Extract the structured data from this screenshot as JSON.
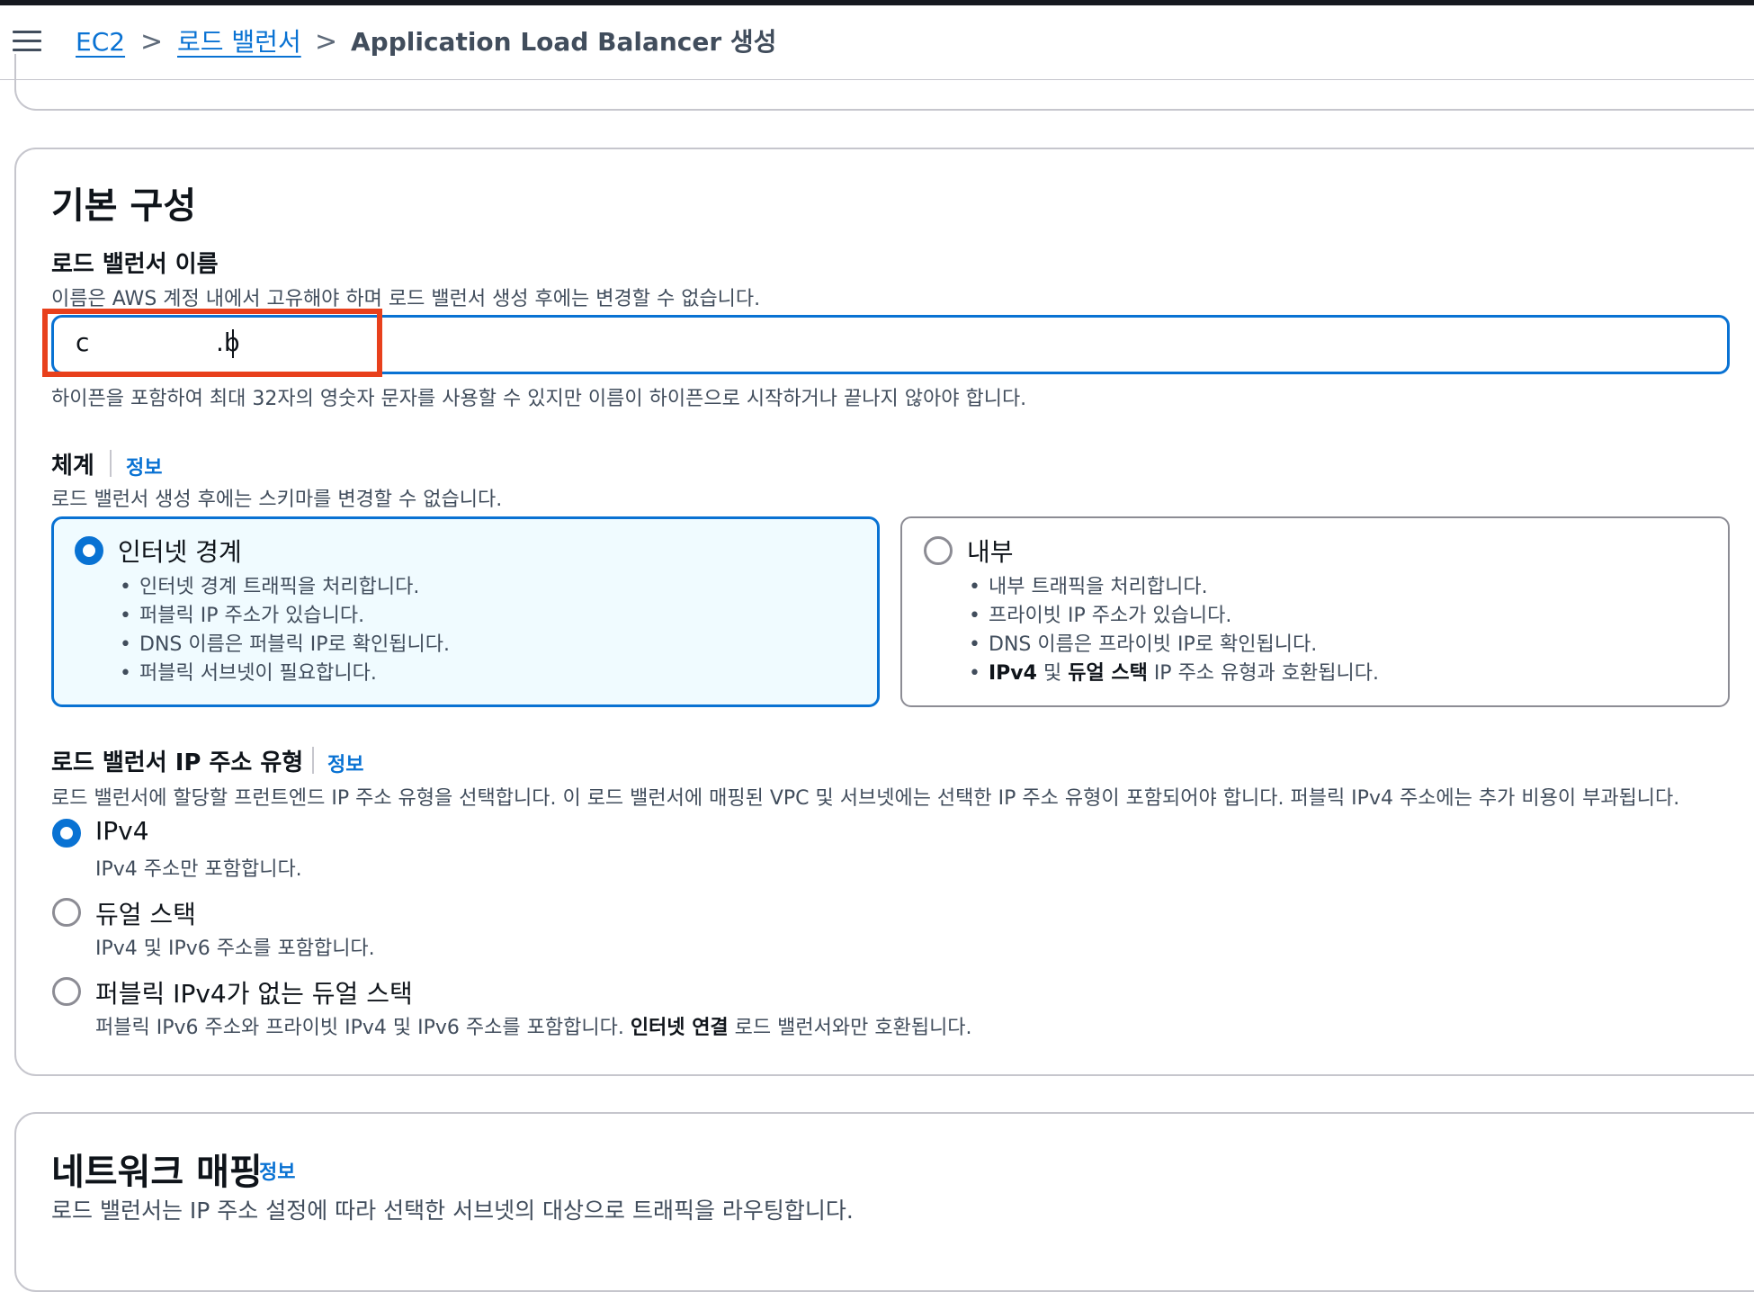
{
  "breadcrumb": {
    "ec2": "EC2",
    "load_balancers": "로드 밸런서",
    "current": "Application Load Balancer 생성",
    "separator": ">"
  },
  "basic_config": {
    "title": "기본 구성",
    "name_label": "로드 밸런서 이름",
    "name_description": "이름은 AWS 계정 내에서 고유해야 하며 로드 밸런서 생성 후에는 변경할 수 없습니다.",
    "name_value_start": "c",
    "name_value_end": ".b",
    "name_constraint": "하이픈을 포함하여 최대 32자의 영숫자 문자를 사용할 수 있지만 이름이 하이픈으로 시작하거나 끝나지 않아야 합니다.",
    "scheme": {
      "label": "체계",
      "info": "정보",
      "description": "로드 밸런서 생성 후에는 스키마를 변경할 수 없습니다.",
      "options": [
        {
          "title": "인터넷 경계",
          "selected": true,
          "bullets": [
            "인터넷 경계 트래픽을 처리합니다.",
            "퍼블릭 IP 주소가 있습니다.",
            "DNS 이름은 퍼블릭 IP로 확인됩니다.",
            "퍼블릭 서브넷이 필요합니다."
          ]
        },
        {
          "title": "내부",
          "selected": false,
          "bullets": [
            "내부 트래픽을 처리합니다.",
            "프라이빗 IP 주소가 있습니다.",
            "DNS 이름은 프라이빗 IP로 확인됩니다."
          ],
          "last_bullet": {
            "b1": "IPv4",
            "t1": " 및 ",
            "b2": "듀얼 스택",
            "t2": " IP 주소 유형과 호환됩니다."
          }
        }
      ]
    },
    "ip_type": {
      "label": "로드 밸런서 IP 주소 유형",
      "info": "정보",
      "description": "로드 밸런서에 할당할 프런트엔드 IP 주소 유형을 선택합니다. 이 로드 밸런서에 매핑된 VPC 및 서브넷에는 선택한 IP 주소 유형이 포함되어야 합니다. 퍼블릭 IPv4 주소에는 추가 비용이 부과됩니다.",
      "options": [
        {
          "title": "IPv4",
          "description": "IPv4 주소만 포함합니다.",
          "selected": true
        },
        {
          "title": "듀얼 스택",
          "description": "IPv4 및 IPv6 주소를 포함합니다.",
          "selected": false
        },
        {
          "title": "퍼블릭 IPv4가 없는 듀얼 스택",
          "selected": false,
          "desc_pre": "퍼블릭 IPv6 주소와 프라이빗 IPv4 및 IPv6 주소를 포함합니다. ",
          "desc_bold": "인터넷 연결",
          "desc_post": " 로드 밸런서와만 호환됩니다."
        }
      ]
    }
  },
  "network_mapping": {
    "title": "네트워크 매핑",
    "info": "정보",
    "description": "로드 밸런서는 IP 주소 설정에 따라 선택한 서브넷의 대상으로 트래픽을 라우팅합니다."
  },
  "colors": {
    "accent": "#0972d3",
    "highlight_box": "#e8401c",
    "selected_tile_bg": "#f0fbff",
    "border": "#c6c6cd"
  },
  "icons": {
    "menu": "hamburger-menu-icon",
    "breadcrumb_separator": "chevron-right-icon"
  }
}
